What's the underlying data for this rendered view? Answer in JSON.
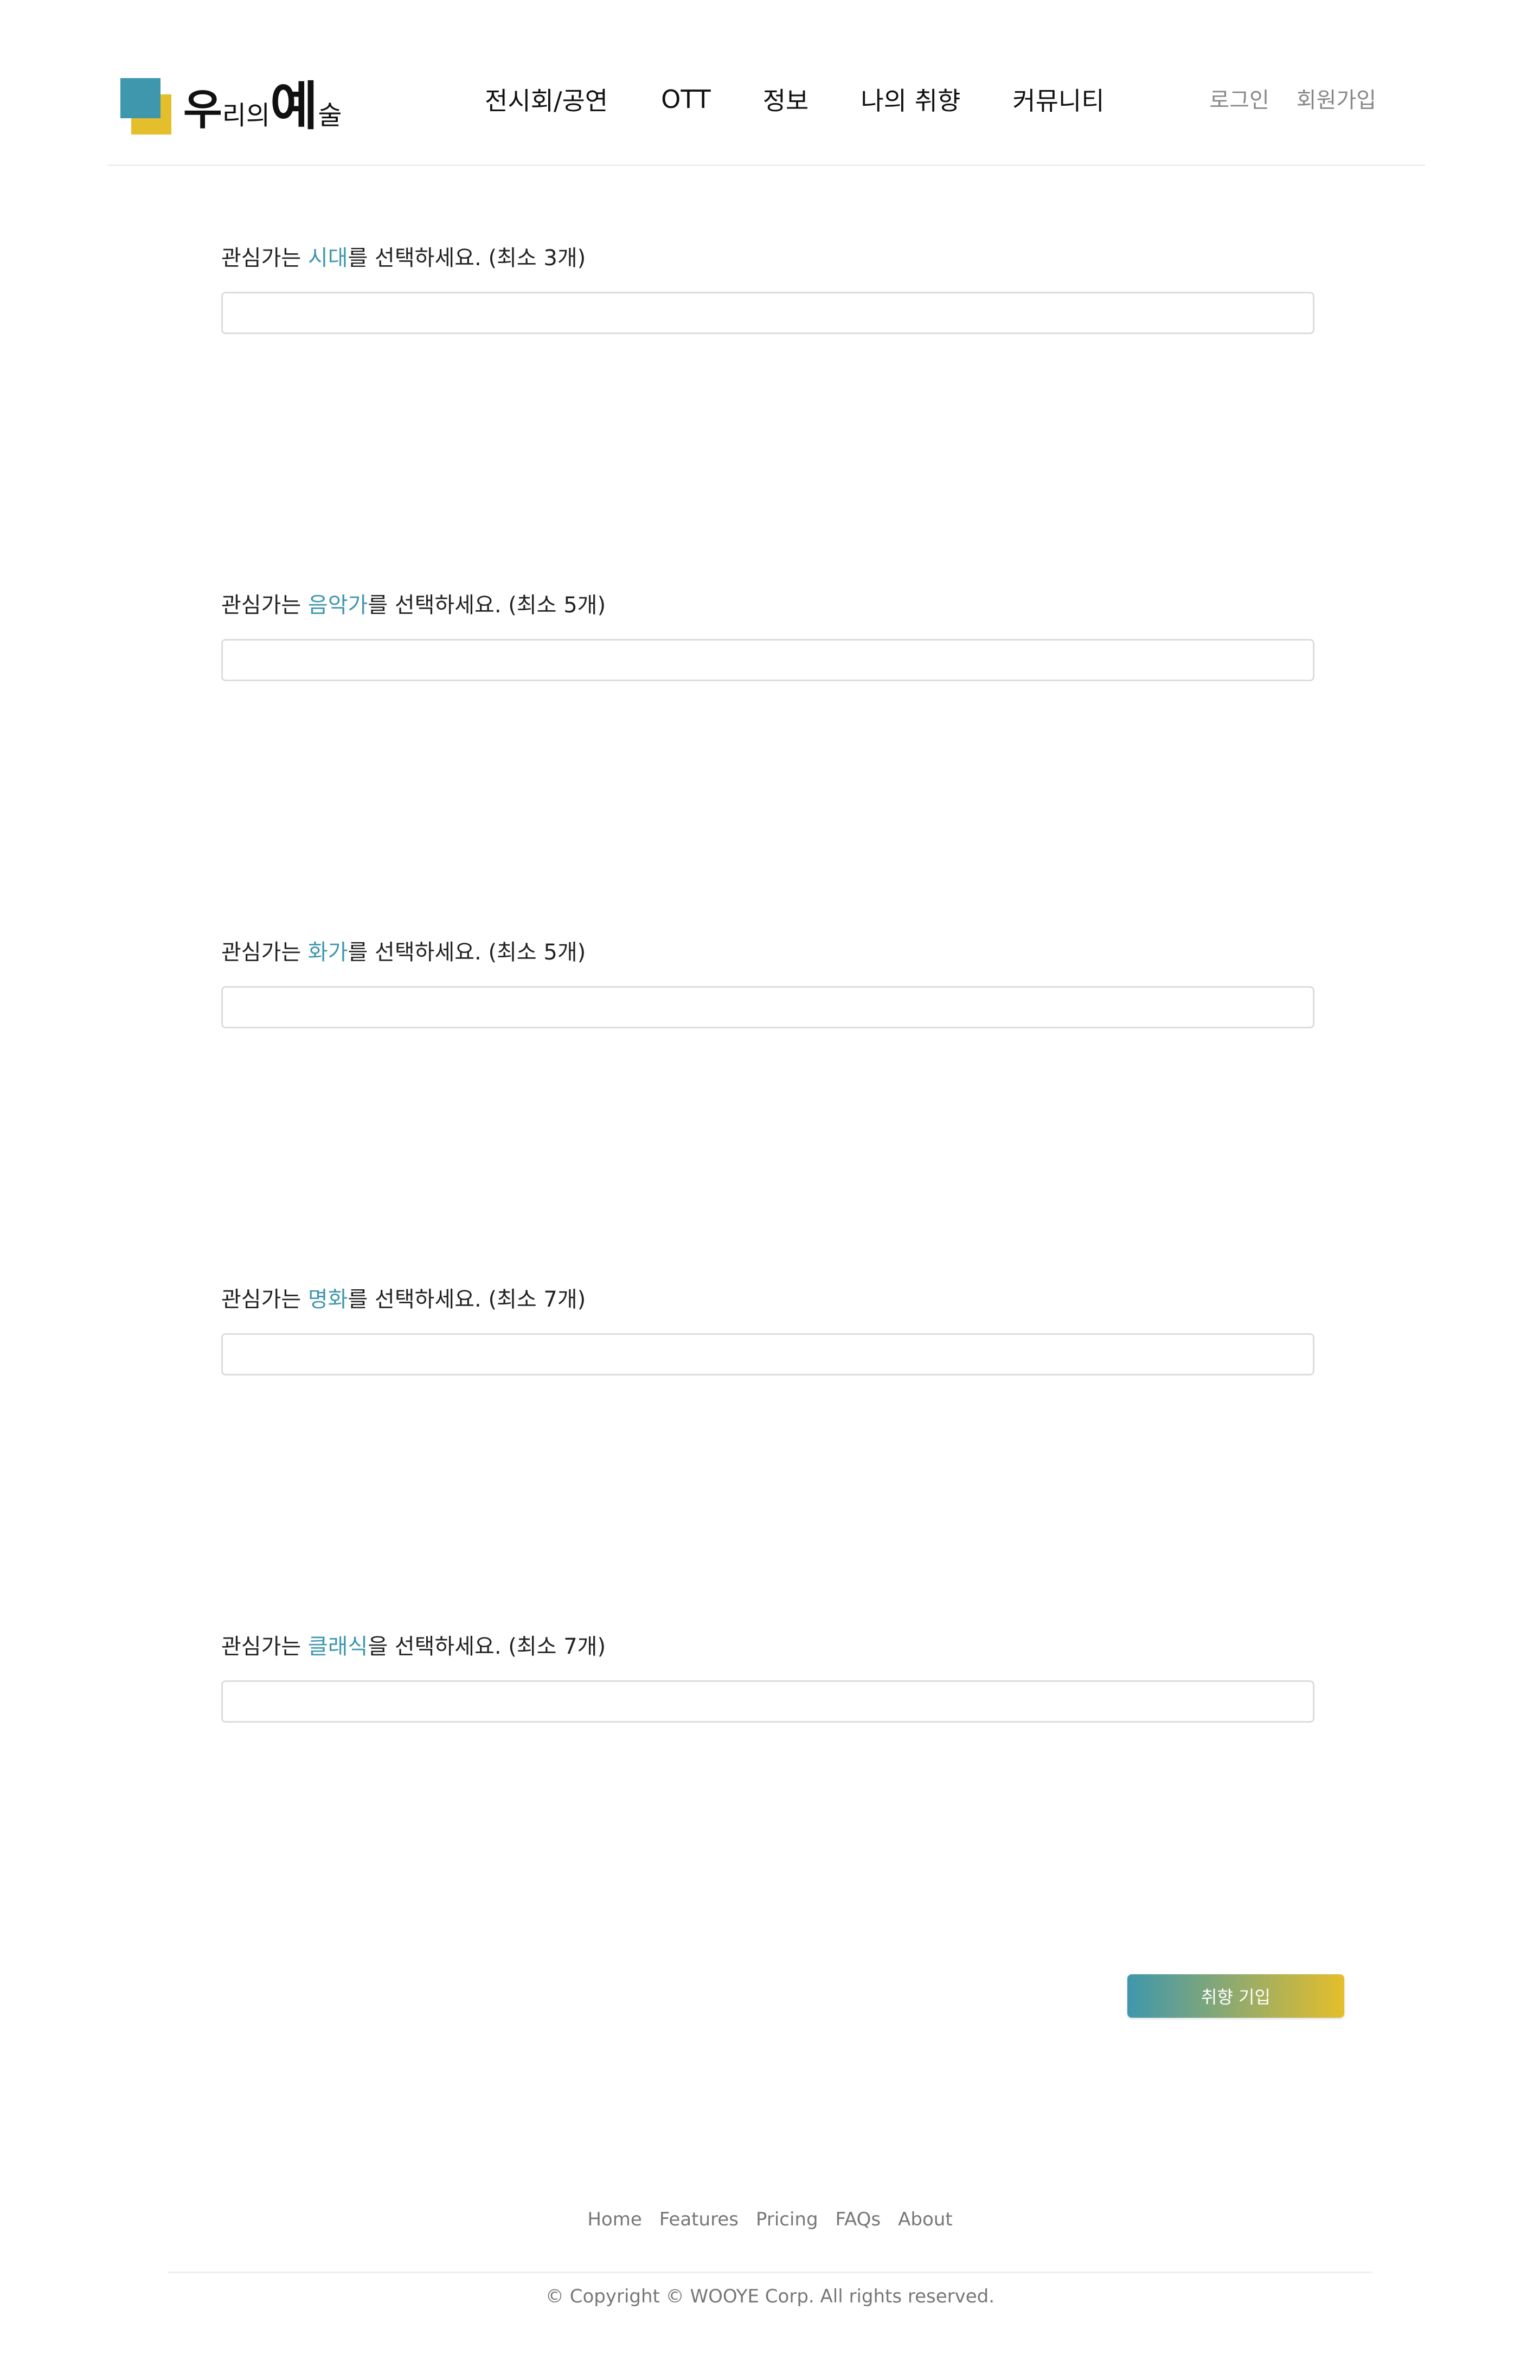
{
  "brand": {
    "logo_part1": "우",
    "logo_part2": "리의",
    "logo_part3": "예",
    "logo_part4": "술",
    "colors": {
      "primary": "#3f97ad",
      "secondary": "#e5be2b"
    }
  },
  "nav": {
    "items": [
      {
        "label": "전시회/공연"
      },
      {
        "label": "OTT"
      },
      {
        "label": "정보"
      },
      {
        "label": "나의 취향"
      },
      {
        "label": "커뮤니티"
      }
    ]
  },
  "auth": {
    "login": "로그인",
    "signup": "회원가입"
  },
  "questions": [
    {
      "prefix": "관심가는 ",
      "highlight": "시대",
      "suffix": "를 선택하세요. (최소 3개)",
      "value": ""
    },
    {
      "prefix": "관심가는 ",
      "highlight": "음악가",
      "suffix": "를 선택하세요. (최소 5개)",
      "value": ""
    },
    {
      "prefix": "관심가는 ",
      "highlight": "화가",
      "suffix": "를 선택하세요. (최소 5개)",
      "value": ""
    },
    {
      "prefix": "관심가는 ",
      "highlight": "명화",
      "suffix": "를 선택하세요. (최소 7개)",
      "value": ""
    },
    {
      "prefix": "관심가는 ",
      "highlight": "클래식",
      "suffix": "을 선택하세요. (최소 7개)",
      "value": ""
    }
  ],
  "submit_label": "취향 기입",
  "footer": {
    "links": [
      "Home",
      "Features",
      "Pricing",
      "FAQs",
      "About"
    ],
    "copyright": "© Copyright © WOOYE Corp. All rights reserved."
  }
}
